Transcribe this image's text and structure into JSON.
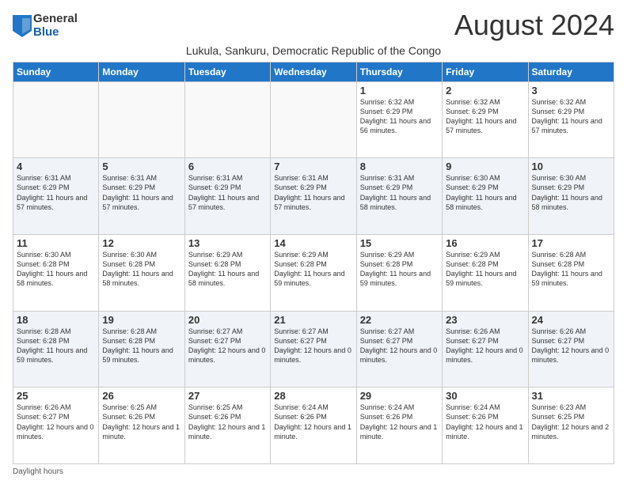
{
  "logo": {
    "general": "General",
    "blue": "Blue"
  },
  "title": "August 2024",
  "subtitle": "Lukula, Sankuru, Democratic Republic of the Congo",
  "days_of_week": [
    "Sunday",
    "Monday",
    "Tuesday",
    "Wednesday",
    "Thursday",
    "Friday",
    "Saturday"
  ],
  "footer_label": "Daylight hours",
  "weeks": [
    [
      {
        "day": "",
        "info": ""
      },
      {
        "day": "",
        "info": ""
      },
      {
        "day": "",
        "info": ""
      },
      {
        "day": "",
        "info": ""
      },
      {
        "day": "1",
        "info": "Sunrise: 6:32 AM\nSunset: 6:29 PM\nDaylight: 11 hours and 56 minutes."
      },
      {
        "day": "2",
        "info": "Sunrise: 6:32 AM\nSunset: 6:29 PM\nDaylight: 11 hours and 57 minutes."
      },
      {
        "day": "3",
        "info": "Sunrise: 6:32 AM\nSunset: 6:29 PM\nDaylight: 11 hours and 57 minutes."
      }
    ],
    [
      {
        "day": "4",
        "info": "Sunrise: 6:31 AM\nSunset: 6:29 PM\nDaylight: 11 hours and 57 minutes."
      },
      {
        "day": "5",
        "info": "Sunrise: 6:31 AM\nSunset: 6:29 PM\nDaylight: 11 hours and 57 minutes."
      },
      {
        "day": "6",
        "info": "Sunrise: 6:31 AM\nSunset: 6:29 PM\nDaylight: 11 hours and 57 minutes."
      },
      {
        "day": "7",
        "info": "Sunrise: 6:31 AM\nSunset: 6:29 PM\nDaylight: 11 hours and 57 minutes."
      },
      {
        "day": "8",
        "info": "Sunrise: 6:31 AM\nSunset: 6:29 PM\nDaylight: 11 hours and 58 minutes."
      },
      {
        "day": "9",
        "info": "Sunrise: 6:30 AM\nSunset: 6:29 PM\nDaylight: 11 hours and 58 minutes."
      },
      {
        "day": "10",
        "info": "Sunrise: 6:30 AM\nSunset: 6:29 PM\nDaylight: 11 hours and 58 minutes."
      }
    ],
    [
      {
        "day": "11",
        "info": "Sunrise: 6:30 AM\nSunset: 6:28 PM\nDaylight: 11 hours and 58 minutes."
      },
      {
        "day": "12",
        "info": "Sunrise: 6:30 AM\nSunset: 6:28 PM\nDaylight: 11 hours and 58 minutes."
      },
      {
        "day": "13",
        "info": "Sunrise: 6:29 AM\nSunset: 6:28 PM\nDaylight: 11 hours and 58 minutes."
      },
      {
        "day": "14",
        "info": "Sunrise: 6:29 AM\nSunset: 6:28 PM\nDaylight: 11 hours and 59 minutes."
      },
      {
        "day": "15",
        "info": "Sunrise: 6:29 AM\nSunset: 6:28 PM\nDaylight: 11 hours and 59 minutes."
      },
      {
        "day": "16",
        "info": "Sunrise: 6:29 AM\nSunset: 6:28 PM\nDaylight: 11 hours and 59 minutes."
      },
      {
        "day": "17",
        "info": "Sunrise: 6:28 AM\nSunset: 6:28 PM\nDaylight: 11 hours and 59 minutes."
      }
    ],
    [
      {
        "day": "18",
        "info": "Sunrise: 6:28 AM\nSunset: 6:28 PM\nDaylight: 11 hours and 59 minutes."
      },
      {
        "day": "19",
        "info": "Sunrise: 6:28 AM\nSunset: 6:28 PM\nDaylight: 11 hours and 59 minutes."
      },
      {
        "day": "20",
        "info": "Sunrise: 6:27 AM\nSunset: 6:27 PM\nDaylight: 12 hours and 0 minutes."
      },
      {
        "day": "21",
        "info": "Sunrise: 6:27 AM\nSunset: 6:27 PM\nDaylight: 12 hours and 0 minutes."
      },
      {
        "day": "22",
        "info": "Sunrise: 6:27 AM\nSunset: 6:27 PM\nDaylight: 12 hours and 0 minutes."
      },
      {
        "day": "23",
        "info": "Sunrise: 6:26 AM\nSunset: 6:27 PM\nDaylight: 12 hours and 0 minutes."
      },
      {
        "day": "24",
        "info": "Sunrise: 6:26 AM\nSunset: 6:27 PM\nDaylight: 12 hours and 0 minutes."
      }
    ],
    [
      {
        "day": "25",
        "info": "Sunrise: 6:26 AM\nSunset: 6:27 PM\nDaylight: 12 hours and 0 minutes."
      },
      {
        "day": "26",
        "info": "Sunrise: 6:25 AM\nSunset: 6:26 PM\nDaylight: 12 hours and 1 minute."
      },
      {
        "day": "27",
        "info": "Sunrise: 6:25 AM\nSunset: 6:26 PM\nDaylight: 12 hours and 1 minute."
      },
      {
        "day": "28",
        "info": "Sunrise: 6:24 AM\nSunset: 6:26 PM\nDaylight: 12 hours and 1 minute."
      },
      {
        "day": "29",
        "info": "Sunrise: 6:24 AM\nSunset: 6:26 PM\nDaylight: 12 hours and 1 minute."
      },
      {
        "day": "30",
        "info": "Sunrise: 6:24 AM\nSunset: 6:26 PM\nDaylight: 12 hours and 1 minute."
      },
      {
        "day": "31",
        "info": "Sunrise: 6:23 AM\nSunset: 6:25 PM\nDaylight: 12 hours and 2 minutes."
      }
    ]
  ]
}
